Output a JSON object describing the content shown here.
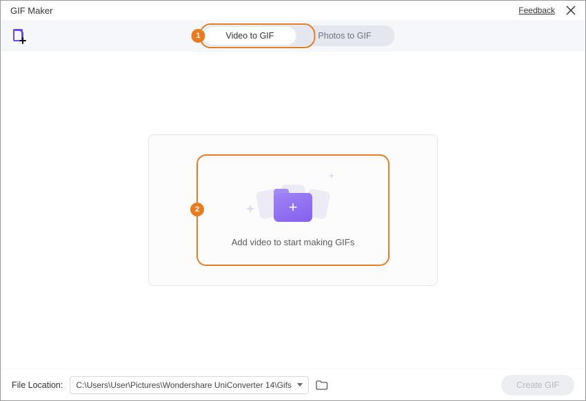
{
  "window": {
    "title": "GIF Maker"
  },
  "header": {
    "feedback": "Feedback"
  },
  "tabs": {
    "video": "Video to GIF",
    "photos": "Photos to GIF"
  },
  "callouts": {
    "one": "1",
    "two": "2"
  },
  "dropzone": {
    "prompt": "Add video to start making GIFs"
  },
  "footer": {
    "label": "File Location:",
    "path": "C:\\Users\\User\\Pictures\\Wondershare UniConverter 14\\Gifs",
    "create": "Create GIF"
  }
}
